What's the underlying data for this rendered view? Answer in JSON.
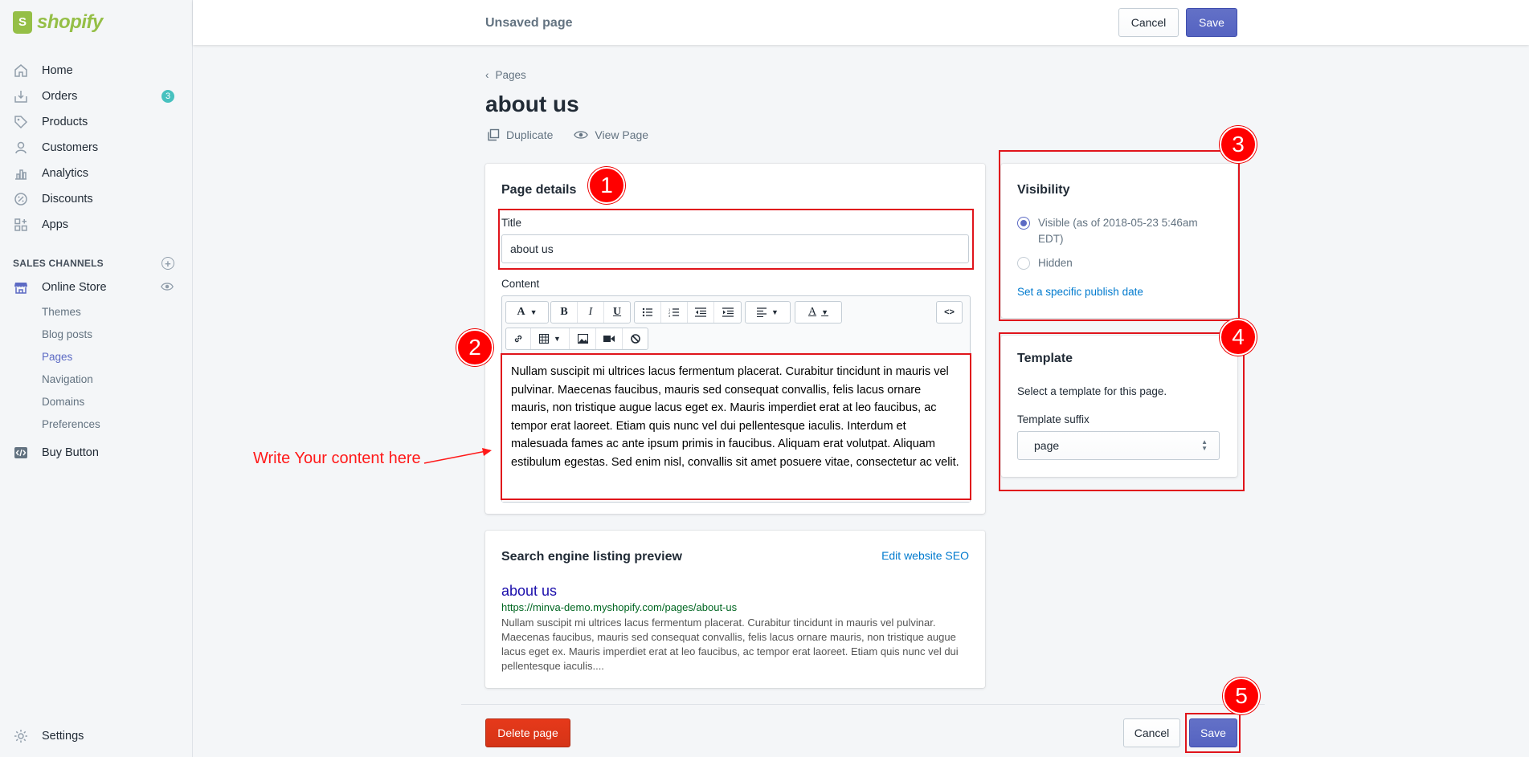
{
  "app": {
    "brand": "shopify"
  },
  "sidebar": {
    "items": [
      {
        "label": "Home",
        "icon": "home-icon"
      },
      {
        "label": "Orders",
        "icon": "orders-icon",
        "badge": "3"
      },
      {
        "label": "Products",
        "icon": "tag-icon"
      },
      {
        "label": "Customers",
        "icon": "person-icon"
      },
      {
        "label": "Analytics",
        "icon": "bar-chart-icon"
      },
      {
        "label": "Discounts",
        "icon": "discount-icon"
      },
      {
        "label": "Apps",
        "icon": "apps-icon"
      }
    ],
    "sales_channels_label": "SALES CHANNELS",
    "online_store": "Online Store",
    "subitems": [
      "Themes",
      "Blog posts",
      "Pages",
      "Navigation",
      "Domains",
      "Preferences"
    ],
    "active_subitem": "Pages",
    "buy_button": "Buy Button",
    "settings": "Settings"
  },
  "topbar": {
    "title": "Unsaved page",
    "cancel": "Cancel",
    "save": "Save"
  },
  "page": {
    "breadcrumb": "Pages",
    "title": "about us",
    "duplicate": "Duplicate",
    "view_page": "View Page"
  },
  "details": {
    "heading": "Page details",
    "title_label": "Title",
    "title_value": "about us",
    "content_label": "Content",
    "content_text": "Nullam suscipit mi ultrices lacus fermentum placerat. Curabitur tincidunt in mauris vel pulvinar. Maecenas faucibus, mauris sed consequat convallis, felis lacus ornare mauris, non tristique augue lacus eget ex. Mauris imperdiet erat at leo faucibus, ac tempor erat laoreet. Etiam quis nunc vel dui pellentesque iaculis. Interdum et malesuada fames ac ante ipsum primis in faucibus. Aliquam erat volutpat. Aliquam estibulum egestas. Sed enim nisl, convallis sit amet posuere vitae, consectetur ac velit.",
    "toolbar": {
      "html_button": "<>"
    }
  },
  "seo": {
    "heading": "Search engine listing preview",
    "edit_link": "Edit website SEO",
    "preview_title": "about us",
    "preview_url": "https://minva-demo.myshopify.com/pages/about-us",
    "preview_desc": "Nullam suscipit mi ultrices lacus fermentum placerat. Curabitur tincidunt in mauris vel pulvinar. Maecenas faucibus, mauris sed consequat convallis, felis lacus ornare mauris, non tristique augue lacus eget ex. Mauris imperdiet erat at leo faucibus, ac tempor erat laoreet. Etiam quis nunc vel dui pellentesque iaculis...."
  },
  "visibility": {
    "heading": "Visibility",
    "visible_label": "Visible (as of 2018-05-23 5:46am EDT)",
    "hidden_label": "Hidden",
    "selected": "visible",
    "publish_link": "Set a specific publish date"
  },
  "template": {
    "heading": "Template",
    "help": "Select a template for this page.",
    "suffix_label": "Template suffix",
    "suffix_value": "page"
  },
  "footer": {
    "delete": "Delete page",
    "cancel": "Cancel",
    "save": "Save"
  },
  "annotations": {
    "markers": [
      "1",
      "2",
      "3",
      "4",
      "5"
    ],
    "arrow_text": "Write Your content here",
    "color": "#ff0000"
  },
  "colors": {
    "primary": "#5c6ac4",
    "danger": "#de3618",
    "link": "#007ace",
    "seo_title": "#1a0dab",
    "seo_url": "#006621",
    "badge": "#47c1bf"
  }
}
